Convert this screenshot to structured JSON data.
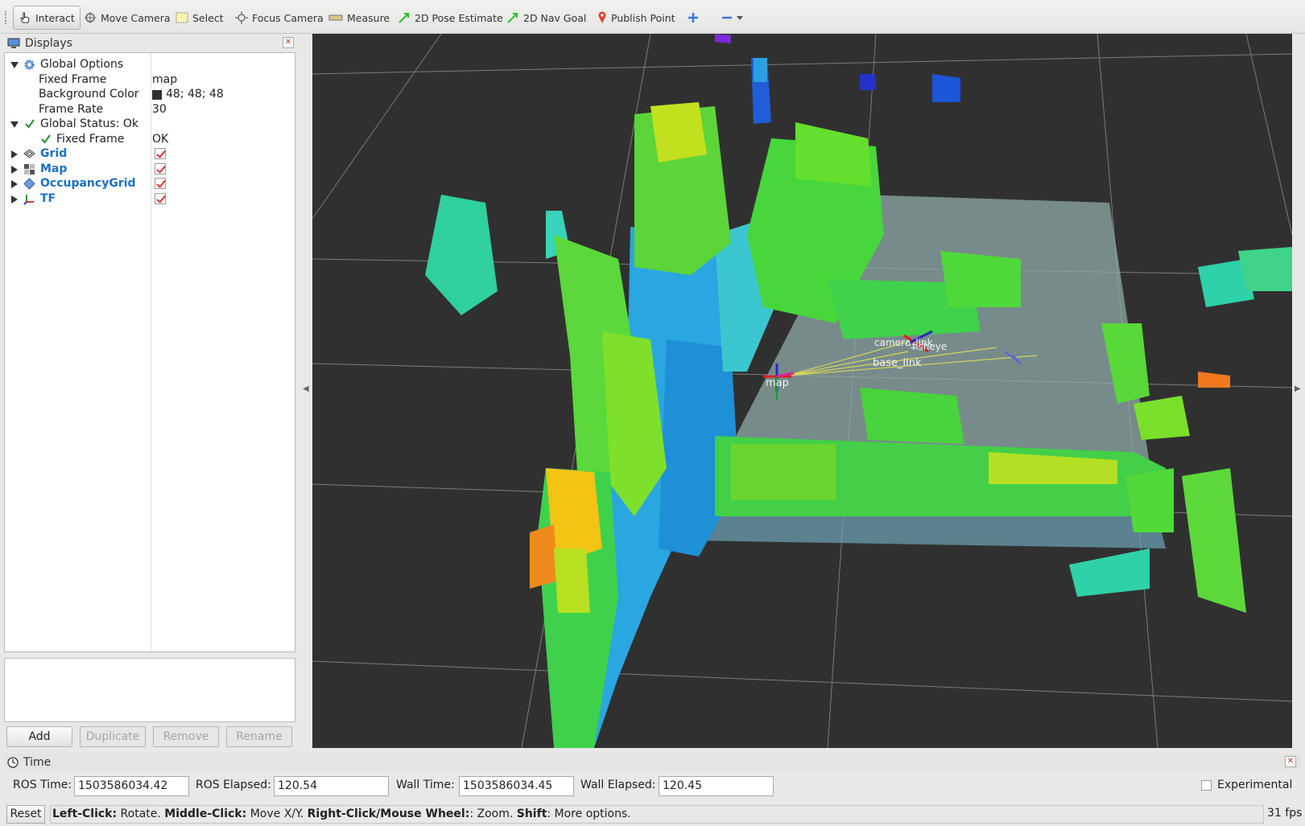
{
  "toolbar": {
    "tools": [
      {
        "label": "Interact",
        "icon": "hand-cursor-icon"
      },
      {
        "label": "Move Camera",
        "icon": "move-camera-icon"
      },
      {
        "label": "Select",
        "icon": "select-rect-icon"
      },
      {
        "label": "Focus Camera",
        "icon": "focus-crosshair-icon"
      },
      {
        "label": "Measure",
        "icon": "ruler-icon"
      },
      {
        "label": "2D Pose Estimate",
        "icon": "green-arrow-icon"
      },
      {
        "label": "2D Nav Goal",
        "icon": "green-arrow-icon"
      },
      {
        "label": "Publish Point",
        "icon": "map-pin-icon"
      }
    ]
  },
  "displays": {
    "title": "Displays",
    "tree": [
      {
        "name": "Global Options",
        "value": ""
      },
      {
        "name": "Fixed Frame",
        "value": "map"
      },
      {
        "name": "Background Color",
        "value": "48; 48; 48"
      },
      {
        "name": "Frame Rate",
        "value": "30"
      },
      {
        "name": "Global Status: Ok",
        "value": ""
      },
      {
        "name": "Fixed Frame",
        "value": "OK"
      },
      {
        "name": "Grid",
        "value": ""
      },
      {
        "name": "Map",
        "value": ""
      },
      {
        "name": "OccupancyGrid",
        "value": ""
      },
      {
        "name": "TF",
        "value": ""
      }
    ],
    "buttons": {
      "add": "Add",
      "duplicate": "Duplicate",
      "remove": "Remove",
      "rename": "Rename"
    }
  },
  "viewport": {
    "labels": {
      "map": "map",
      "base_link": "base_link",
      "camera": "camera_link",
      "fisheye": "fisheye"
    },
    "colors": {
      "background": "#303030",
      "grid": "#7a7a7a"
    }
  },
  "time": {
    "title": "Time",
    "ros_time_label": "ROS Time:",
    "ros_time": "1503586034.42",
    "ros_elapsed_label": "ROS Elapsed:",
    "ros_elapsed": "120.54",
    "wall_time_label": "Wall Time:",
    "wall_time": "1503586034.45",
    "wall_elapsed_label": "Wall Elapsed:",
    "wall_elapsed": "120.45",
    "experimental_label": "Experimental"
  },
  "status": {
    "reset": "Reset",
    "hint": {
      "left_click": "Left-Click:",
      "left_click_action": " Rotate. ",
      "middle_click": "Middle-Click:",
      "middle_click_action": " Move X/Y. ",
      "right_click": "Right-Click/Mouse Wheel:",
      "right_click_action": ": Zoom. ",
      "shift": "Shift",
      "shift_action": ": More options."
    },
    "fps": "31 fps"
  }
}
